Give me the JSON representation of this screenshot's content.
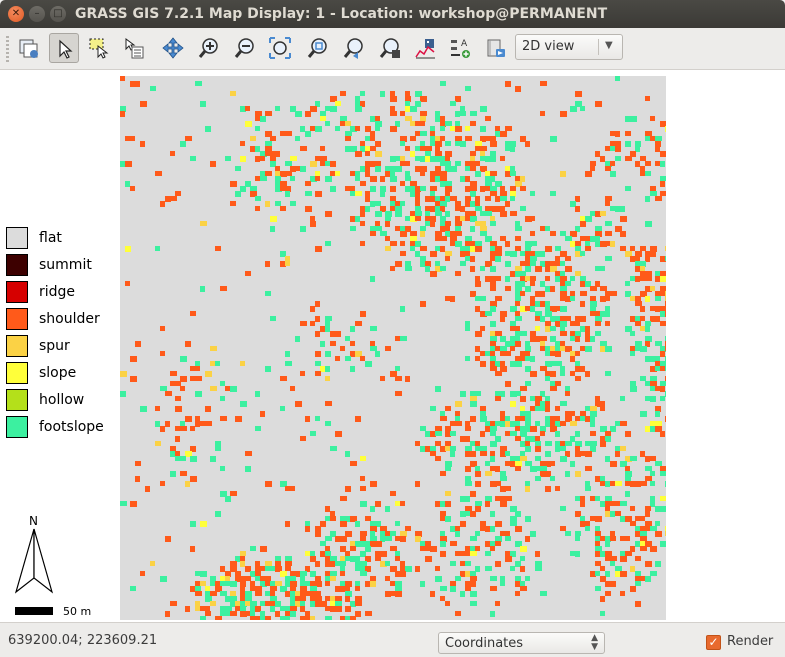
{
  "window": {
    "title": "GRASS GIS 7.2.1 Map Display: 1 - Location: workshop@PERMANENT",
    "buttons": [
      "close-icon",
      "minimize-icon",
      "maximize-icon"
    ]
  },
  "toolbar": {
    "tools": [
      {
        "name": "add-map-layers",
        "icon": "layers-icon"
      },
      {
        "name": "pointer",
        "icon": "pointer-icon",
        "active": true
      },
      {
        "name": "select-region",
        "icon": "select-region-icon"
      },
      {
        "name": "query",
        "icon": "query-icon"
      },
      {
        "name": "pan",
        "icon": "pan-icon"
      },
      {
        "name": "zoom-in",
        "icon": "zoom-in-icon"
      },
      {
        "name": "zoom-out",
        "icon": "zoom-out-icon"
      },
      {
        "name": "zoom-extent",
        "icon": "zoom-extent-icon"
      },
      {
        "name": "zoom-region",
        "icon": "zoom-region-icon"
      },
      {
        "name": "zoom-back",
        "icon": "zoom-back-icon"
      },
      {
        "name": "zoom-menu",
        "icon": "zoom-menu-icon"
      },
      {
        "name": "analyze",
        "icon": "analyze-icon"
      },
      {
        "name": "decorations",
        "icon": "decorations-icon"
      },
      {
        "name": "save-image",
        "icon": "save-image-icon"
      }
    ],
    "view_mode": "2D view"
  },
  "legend": {
    "items": [
      {
        "label": "flat",
        "color": "#dcdcdc"
      },
      {
        "label": "summit",
        "color": "#3d0000"
      },
      {
        "label": "ridge",
        "color": "#d60000"
      },
      {
        "label": "shoulder",
        "color": "#ff5a1a"
      },
      {
        "label": "spur",
        "color": "#fbd245"
      },
      {
        "label": "slope",
        "color": "#ffff3a"
      },
      {
        "label": "hollow",
        "color": "#b4e01a"
      },
      {
        "label": "footslope",
        "color": "#3cf0a0"
      }
    ]
  },
  "north_arrow": {
    "label": "N"
  },
  "scale_bar": {
    "label": "50 m"
  },
  "map": {
    "background": "#dcdcdc",
    "shoulder_color": "#ff5a1a",
    "footslope_color": "#3cf0a0",
    "spur_color": "#fbd245",
    "slope_color": "#ffff3a"
  },
  "statusbar": {
    "coordinates": "639200.04; 223609.21",
    "mode": "Coordinates",
    "render_label": "Render",
    "render_checked": true
  }
}
